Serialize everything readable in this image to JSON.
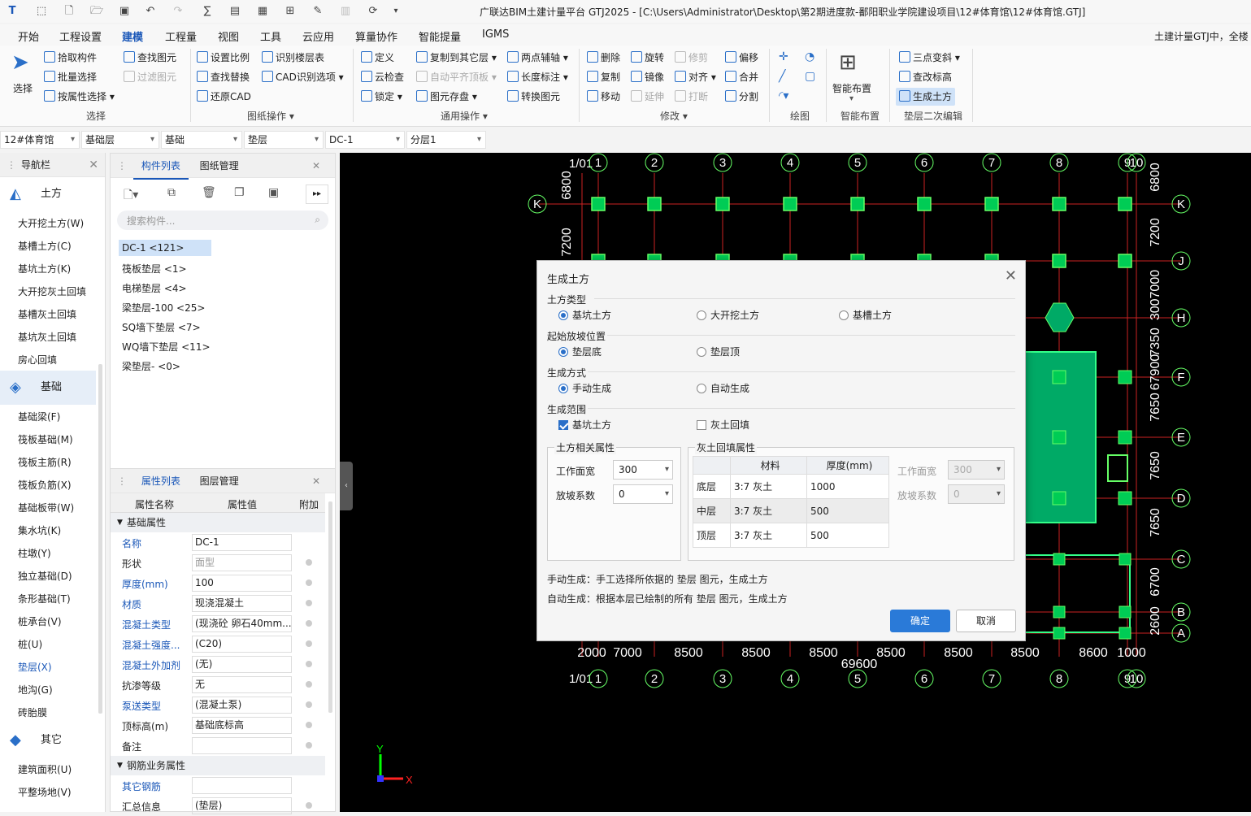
{
  "window": {
    "title": "广联达BIM土建计量平台 GTJ2025 - [C:\\Users\\Administrator\\Desktop\\第2期进度款-鄱阳职业学院建设项目\\12#体育馆\\12#体育馆.GTJ]"
  },
  "menu": [
    "开始",
    "工程设置",
    "建模",
    "工程量",
    "视图",
    "工具",
    "云应用",
    "算量协作",
    "智能提量",
    "IGMS"
  ],
  "menu_active": "建模",
  "search_hint": "土建计量GTJ中，全楼",
  "ribbon": {
    "select_big": "选择",
    "select": [
      "拾取构件",
      "批量选择",
      "按属性选择",
      "查找图元",
      "过滤图元"
    ],
    "select_group": "选择",
    "drawing": [
      "设置比例",
      "识别楼层表",
      "查找替换",
      "CAD识别选项",
      "还原CAD"
    ],
    "drawing_group": "图纸操作",
    "common": [
      "定义",
      "复制到其它层",
      "两点辅轴",
      "云检查",
      "自动平齐顶板",
      "长度标注",
      "锁定",
      "图元存盘",
      "转换图元"
    ],
    "common_group": "通用操作",
    "modify": [
      "删除",
      "旋转",
      "修剪",
      "偏移",
      "复制",
      "镜像",
      "对齐",
      "合并",
      "移动",
      "延伸",
      "打断",
      "分割"
    ],
    "modify_group": "修改",
    "draw_group": "绘图",
    "smart_big": "智能布置",
    "smart_group": "智能布置",
    "cushion": [
      "三点变斜",
      "查改标高",
      "生成土方"
    ],
    "cushion_group": "垫层二次编辑"
  },
  "layerbar": [
    "12#体育馆",
    "基础层",
    "基础",
    "垫层",
    "DC-1",
    "分层1"
  ],
  "nav": {
    "title": "导航栏",
    "cat_earth": "土方",
    "earth_items": [
      "大开挖土方(W)",
      "基槽土方(C)",
      "基坑土方(K)",
      "大开挖灰土回填",
      "基槽灰土回填",
      "基坑灰土回填",
      "房心回填"
    ],
    "cat_found": "基础",
    "found_items": [
      "基础梁(F)",
      "筏板基础(M)",
      "筏板主筋(R)",
      "筏板负筋(X)",
      "基础板带(W)",
      "集水坑(K)",
      "柱墩(Y)",
      "独立基础(D)",
      "条形基础(T)",
      "桩承台(V)",
      "桩(U)",
      "垫层(X)",
      "地沟(G)",
      "砖胎膜"
    ],
    "cat_other": "其它",
    "other_items": [
      "建筑面积(U)",
      "平整场地(V)"
    ]
  },
  "comp": {
    "tab1": "构件列表",
    "tab2": "图纸管理",
    "search_placeholder": "搜索构件...",
    "items": [
      "DC-1 <121>",
      "筏板垫层 <1>",
      "电梯垫层 <4>",
      "梁垫层-100 <25>",
      "SQ墙下垫层 <7>",
      "WQ墙下垫层 <11>",
      "梁垫层- <0>"
    ]
  },
  "props": {
    "tab1": "属性列表",
    "tab2": "图层管理",
    "h_name": "属性名称",
    "h_value": "属性值",
    "h_extra": "附加",
    "sec1": "基础属性",
    "rows": [
      {
        "n": "名称",
        "v": "DC-1"
      },
      {
        "n": "形状",
        "v": "面型"
      },
      {
        "n": "厚度(mm)",
        "v": "100"
      },
      {
        "n": "材质",
        "v": "现浇混凝土"
      },
      {
        "n": "混凝土类型",
        "v": "(现浇砼 卵石40mm..."
      },
      {
        "n": "混凝土强度...",
        "v": "(C20)"
      },
      {
        "n": "混凝土外加剂",
        "v": "(无)"
      },
      {
        "n": "抗渗等级",
        "v": "无"
      },
      {
        "n": "泵送类型",
        "v": "(混凝土泵)"
      },
      {
        "n": "顶标高(m)",
        "v": "基础底标高"
      },
      {
        "n": "备注",
        "v": ""
      }
    ],
    "sec2": "钢筋业务属性",
    "rows2": [
      {
        "n": "其它钢筋",
        "v": ""
      },
      {
        "n": "汇总信息",
        "v": "(垫层)"
      }
    ]
  },
  "canvas": {
    "col_labels": [
      "1/01",
      "1",
      "2",
      "3",
      "4",
      "5",
      "6",
      "7",
      "8",
      "9",
      "10"
    ],
    "row_labels": [
      "K",
      "J",
      "H",
      "F",
      "E",
      "D",
      "C",
      "B",
      "A"
    ],
    "left_dims": [
      "6800",
      "7200"
    ],
    "right_dims": [
      "6800",
      "7200",
      "3007000",
      "7350",
      "67900",
      "7650",
      "7650",
      "7650",
      "6700",
      "2600"
    ],
    "bottom_dims": [
      "2000",
      "7000",
      "8500",
      "8500",
      "8500",
      "8500",
      "8500",
      "8500",
      "8600",
      "1000"
    ],
    "total": "69600",
    "axis_y": "Y",
    "axis_x": "X"
  },
  "dialog": {
    "title": "生成土方",
    "sec_type": "土方类型",
    "type_opts": [
      "基坑土方",
      "大开挖土方",
      "基槽土方"
    ],
    "sec_slope": "起始放坡位置",
    "slope_opts": [
      "垫层底",
      "垫层顶"
    ],
    "sec_mode": "生成方式",
    "mode_opts": [
      "手动生成",
      "自动生成"
    ],
    "sec_range": "生成范围",
    "range_opts": [
      "基坑土方",
      "灰土回填"
    ],
    "earth_box": "土方相关属性",
    "work_width": "工作面宽",
    "work_width_val": "300",
    "slope_coef": "放坡系数",
    "slope_coef_val": "0",
    "fill_box": "灰土回填属性",
    "th_material": "材料",
    "th_thick": "厚度(mm)",
    "fill_rows": [
      [
        "底层",
        "3:7 灰土",
        "1000"
      ],
      [
        "中层",
        "3:7 灰土",
        "500"
      ],
      [
        "顶层",
        "3:7 灰土",
        "500"
      ]
    ],
    "fill_width": "工作面宽",
    "fill_width_val": "300",
    "fill_slope": "放坡系数",
    "fill_slope_val": "0",
    "note1": "手动生成：手工选择所依据的 垫层 图元，生成土方",
    "note2": "自动生成：根据本层已绘制的所有 垫层 图元，生成土方",
    "ok": "确定",
    "cancel": "取消"
  }
}
